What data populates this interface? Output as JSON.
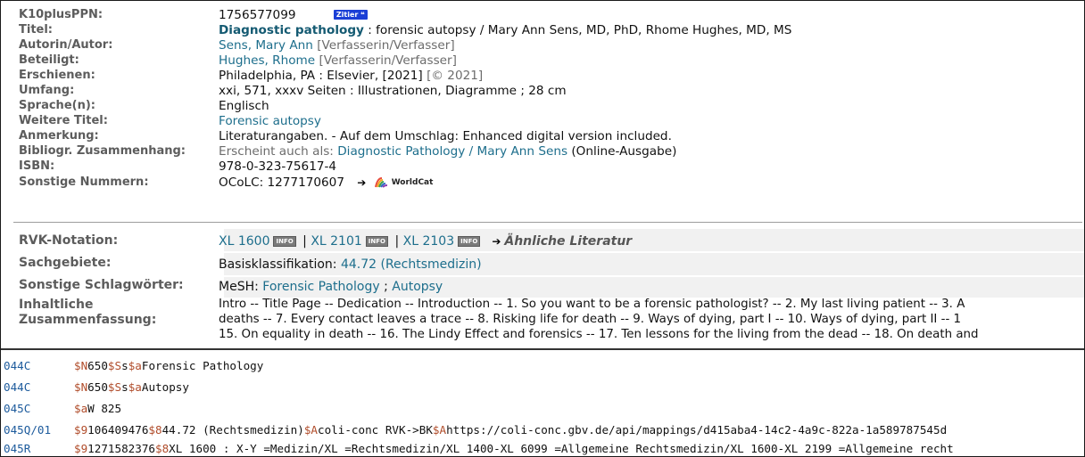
{
  "record": {
    "ppn_label": "K10plusPPN:",
    "ppn_value": "1756577099",
    "zitier_label": "Zitier",
    "titel_label": "Titel:",
    "titel_main": "Diagnostic pathology",
    "titel_rest": " : forensic autopsy / Mary Ann Sens, MD, PhD, Rhome Hughes, MD, MS",
    "autor_label": "Autorin/Autor:",
    "autor_name": "Sens, Mary Ann",
    "autor_role": " [Verfasserin/Verfasser]",
    "beteiligt_label": "Beteiligt:",
    "beteiligt_name": "Hughes, Rhome",
    "beteiligt_role": " [Verfasserin/Verfasser]",
    "erschienen_label": "Erschienen:",
    "erschienen_value": "Philadelphia, PA : Elsevier, [2021]",
    "erschienen_copy": " [© 2021]",
    "umfang_label": "Umfang:",
    "umfang_value": "xxi, 571, xxxv Seiten : Illustrationen, Diagramme ; 28 cm",
    "sprache_label": "Sprache(n):",
    "sprache_value": "Englisch",
    "weitere_label": "Weitere Titel:",
    "weitere_value": "Forensic autopsy",
    "anmerkung_label": "Anmerkung:",
    "anmerkung_value": "Literaturangaben. - Auf dem Umschlag: Enhanced digital version included.",
    "biblio_label": "Bibliogr. Zusammenhang:",
    "biblio_prefix": "Erscheint auch als: ",
    "biblio_link": "Diagnostic Pathology / Mary Ann Sens",
    "biblio_suffix": " (Online-Ausgabe)",
    "isbn_label": "ISBN:",
    "isbn_value": "978-0-323-75617-4",
    "sonstige_nr_label": "Sonstige Nummern:",
    "sonstige_nr_value": "OCoLC: 1277170607",
    "worldcat_label": "WorldCat"
  },
  "subjects": {
    "rvk_label": "RVK-Notation:",
    "rvk_items": [
      "XL 1600",
      "XL 2101",
      "XL 2103"
    ],
    "info_badge": "INFO",
    "separator": " | ",
    "aehnliche": "Ähnliche Literatur",
    "sachgebiete_label": "Sachgebiete:",
    "sachgebiete_prefix": "Basisklassifikation: ",
    "sachgebiete_link": "44.72 (Rechtsmedizin)",
    "schlagwort_label": "Sonstige Schlagwörter:",
    "schlagwort_prefix": "MeSH: ",
    "schlagwort_1": "Forensic Pathology",
    "schlagwort_sep": " ; ",
    "schlagwort_2": "Autopsy",
    "inhalt_label_1": "Inhaltliche",
    "inhalt_label_2": "Zusammenfassung:",
    "inhalt_line_1": "Intro -- Title Page -- Dedication -- Introduction -- 1. So you want to be a forensic pathologist? -- 2. My last living patient -- 3. A",
    "inhalt_line_2": "deaths -- 7. Every contact leaves a trace -- 8. Risking life for death -- 9. Ways of dying, part I -- 10. Ways of dying, part II -- 1",
    "inhalt_line_3": "15. On equality in death -- 16. The Lindy Effect and forensics -- 17. Ten lessons for the living from the dead -- 18. On death and"
  },
  "marc": [
    {
      "tag": "044C",
      "pre": "",
      "parts": [
        [
          "$N",
          "650"
        ],
        [
          "$S",
          "s"
        ],
        [
          "$a",
          "Forensic Pathology"
        ]
      ]
    },
    {
      "tag": "044C",
      "pre": "",
      "parts": [
        [
          "$N",
          "650"
        ],
        [
          "$S",
          "s"
        ],
        [
          "$a",
          "Autopsy"
        ]
      ]
    },
    {
      "tag": "045C",
      "pre": "",
      "parts": [
        [
          "$a",
          "W 825"
        ]
      ]
    },
    {
      "tag": "045Q/01",
      "pre": "",
      "parts": [
        [
          "$9",
          "106409476"
        ],
        [
          "$8",
          "44.72 (Rechtsmedizin)"
        ],
        [
          "$A",
          "coli-conc RVK->BK"
        ],
        [
          "$A",
          "https://coli-conc.gbv.de/api/mappings/d415aba4-14c2-4a9c-822a-1a589787545d"
        ]
      ]
    },
    {
      "tag": "045R",
      "pre": "",
      "parts": [
        [
          "$9",
          "1271582376"
        ],
        [
          "$8",
          "XL 1600 : X-Y =Medizin/XL =Rechtsmedizin/XL 1400-XL 6099 =Allgemeine Rechtsmedizin/XL 1600-XL 2199 =Allgemeine recht"
        ]
      ]
    }
  ]
}
